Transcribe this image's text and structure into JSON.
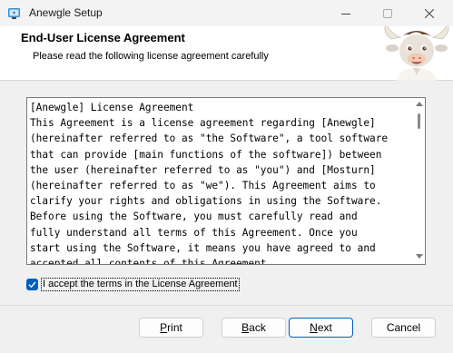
{
  "window": {
    "title": "Anewgle Setup",
    "icon": "installer-icon",
    "controls": [
      "minimize-icon",
      "maximize-icon",
      "close-icon"
    ]
  },
  "header": {
    "title": "End-User License Agreement",
    "subtitle": "Please read the following license agreement carefully",
    "image": "bull-mascot"
  },
  "license": {
    "lines": [
      "[Anewgle] License Agreement",
      "This Agreement is a license agreement regarding [Anewgle]",
      "(hereinafter referred to as \"the Software\", a tool software",
      "that can provide [main functions of the software]) between",
      "the user (hereinafter referred to as \"you\") and [Mosturn]",
      "(hereinafter referred to as \"we\"). This Agreement aims to",
      "clarify your rights and obligations in using the Software.",
      "Before using the Software, you must carefully read and",
      "fully understand all terms of this Agreement. Once you",
      "start using the Software, it means you have agreed to and",
      "accepted all contents of this Agreement."
    ]
  },
  "accept": {
    "checked": true,
    "label": "I accept the terms in the License Agreement"
  },
  "buttons": {
    "print": {
      "access_key": "P",
      "rest": "rint"
    },
    "back": {
      "access_key": "B",
      "rest": "ack"
    },
    "next": {
      "access_key": "N",
      "rest": "ext"
    },
    "cancel": {
      "label": "Cancel"
    }
  },
  "colors": {
    "accent": "#005fb8",
    "header_bg": "#ffffff",
    "window_bg": "#f0f0f0"
  }
}
